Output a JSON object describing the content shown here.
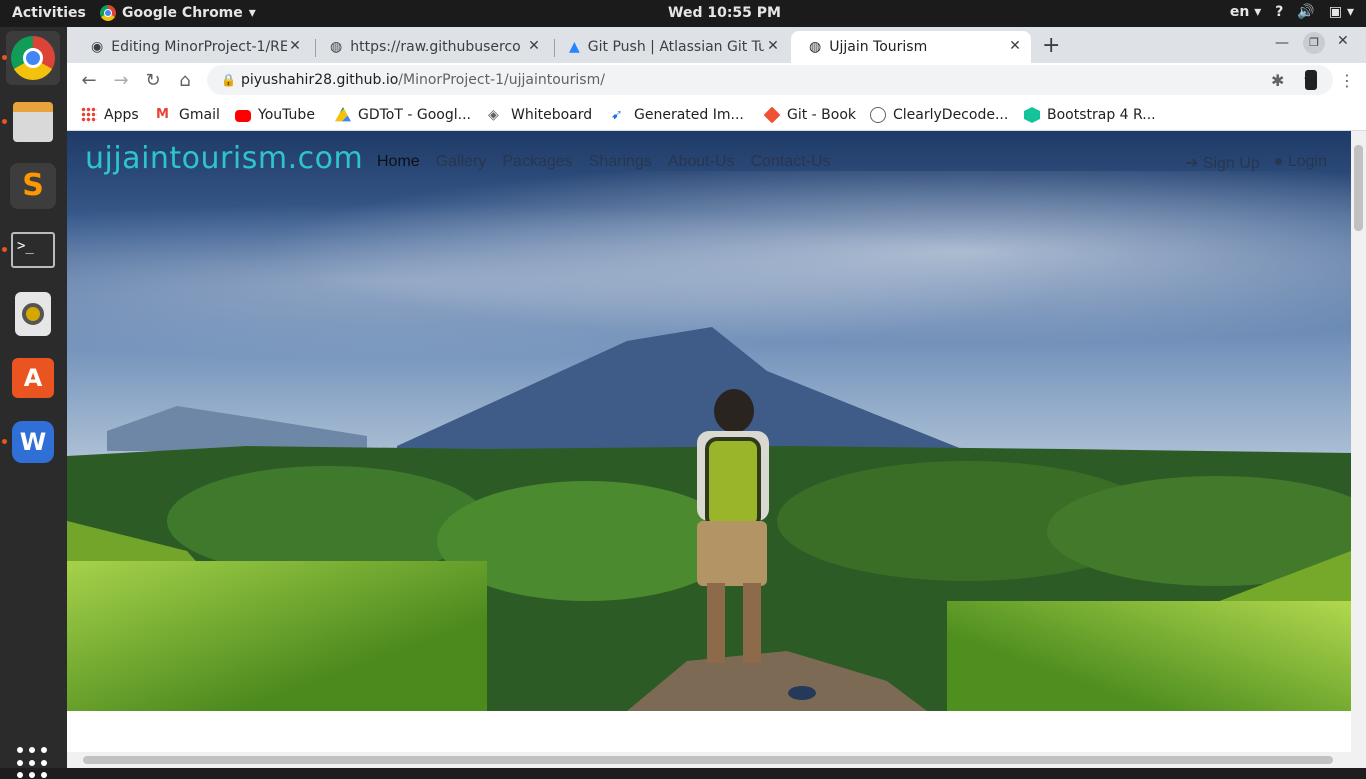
{
  "topbar": {
    "activities": "Activities",
    "app_name": "Google Chrome",
    "clock": "Wed 10:55 PM",
    "lang": "en",
    "help": "?"
  },
  "tabs": [
    {
      "title": "Editing MinorProject-1/RE",
      "icon": "github-icon"
    },
    {
      "title": "https://raw.githubuserco",
      "icon": "globe-icon"
    },
    {
      "title": "Git Push | Atlassian Git Tu",
      "icon": "atlassian-icon"
    },
    {
      "title": "Ujjain Tourism",
      "icon": "globe-icon",
      "active": true
    }
  ],
  "omnibox": {
    "host": "piyushahir28.github.io",
    "path": "/MinorProject-1/ujjaintourism/"
  },
  "bookmarks": [
    {
      "label": "Apps",
      "icon": "apps-grid-icon"
    },
    {
      "label": "Gmail",
      "icon": "gmail-icon"
    },
    {
      "label": "YouTube",
      "icon": "youtube-icon"
    },
    {
      "label": "GDToT - Googl...",
      "icon": "drive-icon"
    },
    {
      "label": "Whiteboard",
      "icon": "whiteboard-icon"
    },
    {
      "label": "Generated Im...",
      "icon": "generated-icon"
    },
    {
      "label": "Git - Book",
      "icon": "git-icon"
    },
    {
      "label": "ClearlyDecode...",
      "icon": "clearlydecoded-icon"
    },
    {
      "label": "Bootstrap 4 R...",
      "icon": "bootstrap-icon"
    }
  ],
  "site": {
    "logo": "ujjaintourism.com",
    "nav": [
      "Home",
      "Gallery",
      "Packages",
      "Sharings",
      "About-Us",
      "Contact-Us"
    ],
    "signup": "Sign Up",
    "login": "Login"
  },
  "colors": {
    "logo": "#2ec4cf",
    "accent": "#1a73e8"
  }
}
